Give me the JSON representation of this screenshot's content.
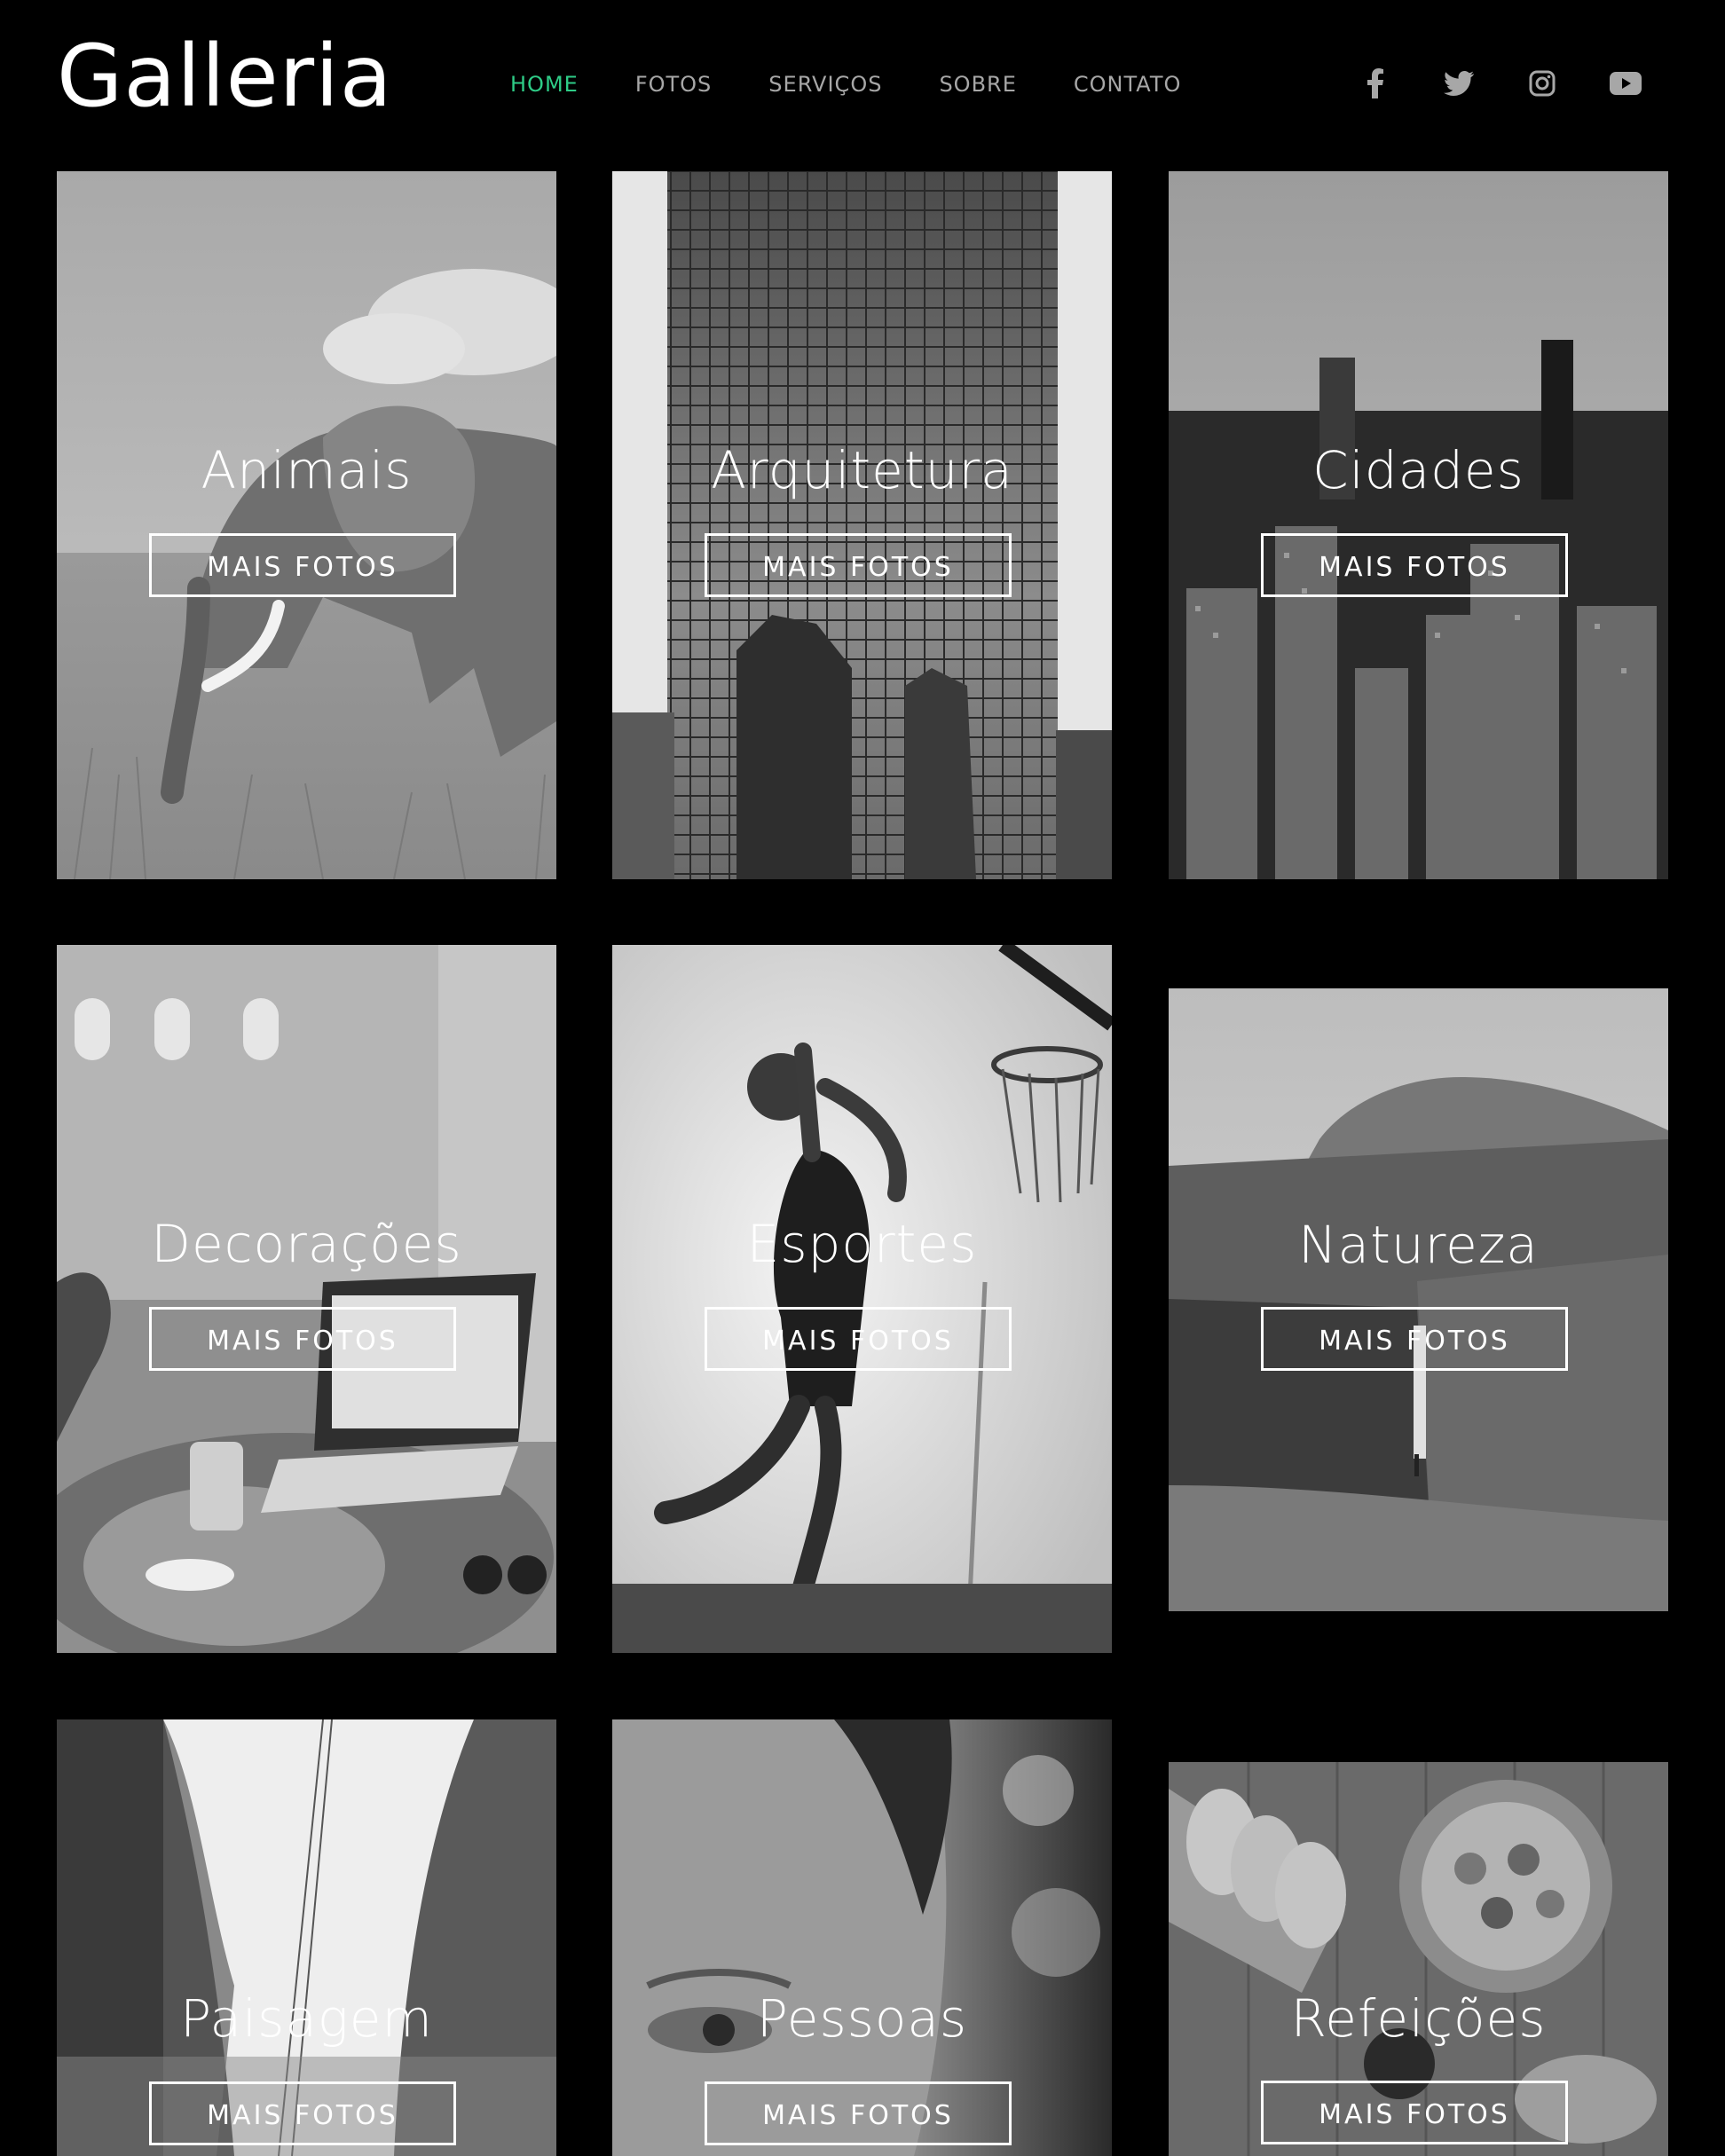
{
  "brand": {
    "name": "Galleria"
  },
  "nav": [
    {
      "label": "HOME",
      "active": true
    },
    {
      "label": "FOTOS",
      "active": false
    },
    {
      "label": "SERVIÇOS",
      "active": false
    },
    {
      "label": "SOBRE",
      "active": false
    },
    {
      "label": "CONTATO",
      "active": false
    }
  ],
  "social": [
    {
      "icon": "facebook-icon"
    },
    {
      "icon": "twitter-icon"
    },
    {
      "icon": "instagram-icon"
    },
    {
      "icon": "youtube-icon"
    }
  ],
  "colors": {
    "background": "#000000",
    "nav_text": "#a7a7a7",
    "nav_active": "#2ecc87",
    "text": "#ffffff"
  },
  "gallery": [
    {
      "title": "Animais",
      "button": "MAIS FOTOS",
      "image": "elephant-photo"
    },
    {
      "title": "Arquitetura",
      "button": "MAIS FOTOS",
      "image": "skyscraper-photo"
    },
    {
      "title": "Cidades",
      "button": "MAIS FOTOS",
      "image": "city-skyline-photo"
    },
    {
      "title": "Decorações",
      "button": "MAIS FOTOS",
      "image": "cafe-table-laptop-photo"
    },
    {
      "title": "Esportes",
      "button": "MAIS FOTOS",
      "image": "basketball-dunk-photo"
    },
    {
      "title": "Natureza",
      "button": "MAIS FOTOS",
      "image": "waterfall-cliff-photo"
    },
    {
      "title": "Paisagem",
      "button": "MAIS FOTOS",
      "image": "forest-canyon-photo"
    },
    {
      "title": "Pessoas",
      "button": "MAIS FOTOS",
      "image": "face-closeup-photo"
    },
    {
      "title": "Refeições",
      "button": "MAIS FOTOS",
      "image": "bread-bowl-food-photo"
    }
  ]
}
